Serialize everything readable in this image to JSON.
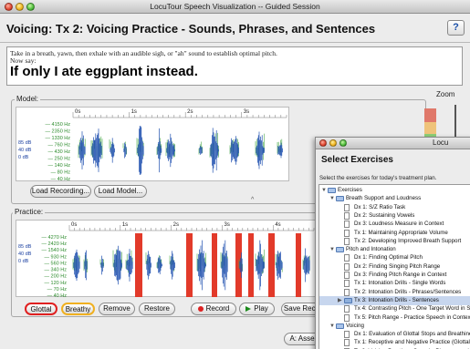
{
  "window": {
    "title": "LocuTour Speech Visualization -- Guided Session"
  },
  "header": {
    "title": "Voicing: Tx 2: Voicing Practice - Sounds, Phrases, and Sentences",
    "help_label": "?"
  },
  "instructions": {
    "line1": "Take in a breath, yawn, then exhale with an audible sigh, or \"ah\" sound to establish optimal pitch.",
    "line2": "Now say:",
    "prompt": "If only I ate eggplant instead."
  },
  "model": {
    "label": "Model:",
    "time_ticks": [
      "0s",
      "1s",
      "2s",
      "3s"
    ],
    "freq_labels": [
      "4150 Hz",
      "2350 Hz",
      "1330 Hz",
      "760 Hz",
      "430 Hz",
      "250 Hz",
      "140 Hz",
      "80 Hz",
      "40 Hz"
    ],
    "db_labels": [
      "85 dB",
      "40 dB",
      "0 dB"
    ],
    "load_recording_label": "Load Recording...",
    "load_model_label": "Load Model..."
  },
  "zoom": {
    "label": "Zoom"
  },
  "practice": {
    "label": "Practice:",
    "time_ticks": [
      "0s",
      "1s",
      "2s",
      "3s",
      "4s"
    ],
    "freq_labels": [
      "4270 Hz",
      "2420 Hz",
      "1540 Hz",
      "930 Hz",
      "560 Hz",
      "340 Hz",
      "200 Hz",
      "120 Hz",
      "70 Hz",
      "40 Hz"
    ],
    "db_labels": [
      "85 dB",
      "40 dB",
      "0 dB"
    ],
    "splitter_label": "^",
    "buttons": {
      "glottal": "Glottal",
      "breathy": "Breathy",
      "remove": "Remove",
      "restore": "Restore",
      "record": "Record",
      "play": "Play",
      "save": "Save Reco"
    }
  },
  "footer": {
    "assess_label": "A: Asses"
  },
  "dialog": {
    "title": "Locu",
    "heading": "Select Exercises",
    "subtitle": "Select the exercises for today's treatment plan.",
    "tree": [
      {
        "label": "Exercises",
        "level": 0,
        "kind": "folder",
        "expanded": true
      },
      {
        "label": "Breath Support and Loudness",
        "level": 1,
        "kind": "folder",
        "expanded": true
      },
      {
        "label": "Dx 1: S/Z Ratio Task",
        "level": 2,
        "kind": "doc"
      },
      {
        "label": "Dx 2: Sustaining Vowels",
        "level": 2,
        "kind": "doc"
      },
      {
        "label": "Dx 3: Loudness Measure in Context",
        "level": 2,
        "kind": "doc"
      },
      {
        "label": "Tx 1: Maintaining Appropriate Volume",
        "level": 2,
        "kind": "doc"
      },
      {
        "label": "Tx 2: Developing Improved Breath Support",
        "level": 2,
        "kind": "doc"
      },
      {
        "label": "Pitch and Intonation",
        "level": 1,
        "kind": "folder",
        "expanded": true
      },
      {
        "label": "Dx 1: Finding Optimal Pitch",
        "level": 2,
        "kind": "doc"
      },
      {
        "label": "Dx 2: Finding Singing Pitch Range",
        "level": 2,
        "kind": "doc"
      },
      {
        "label": "Dx 3: Finding Pitch Range in Context",
        "level": 2,
        "kind": "doc"
      },
      {
        "label": "Tx 1: Intonation Drills - Single Words",
        "level": 2,
        "kind": "doc"
      },
      {
        "label": "Tx 2: Intonation Drills - Phrases/Sentences",
        "level": 2,
        "kind": "doc"
      },
      {
        "label": "Tx 3: Intonation Drills - Sentences",
        "level": 2,
        "kind": "folder",
        "expanded": false,
        "selected": true
      },
      {
        "label": "Tx 4: Contrasting Pitch - One Target Word in Se",
        "level": 2,
        "kind": "doc"
      },
      {
        "label": "Tx 5: Pitch Range - Practice Speech in Context",
        "level": 2,
        "kind": "doc"
      },
      {
        "label": "Voicing",
        "level": 1,
        "kind": "folder",
        "expanded": true
      },
      {
        "label": "Dx 1: Evaluation of Glottal Stops and Breathines",
        "level": 2,
        "kind": "doc"
      },
      {
        "label": "Tx 1: Receptive and Negative Practice (Glottal S",
        "level": 2,
        "kind": "doc"
      },
      {
        "label": "Tx 2: Voicing Practice - Sounds, Phrases, and S",
        "level": 2,
        "kind": "doc"
      }
    ]
  },
  "colors": {
    "accent_green": "#2a8a2a",
    "waveform_blue": "#2050b0",
    "waveform_green": "#49a84a",
    "marker_red": "#e23a2a",
    "glottal_outline": "#e02020",
    "breathy_outline": "#f0b020"
  }
}
